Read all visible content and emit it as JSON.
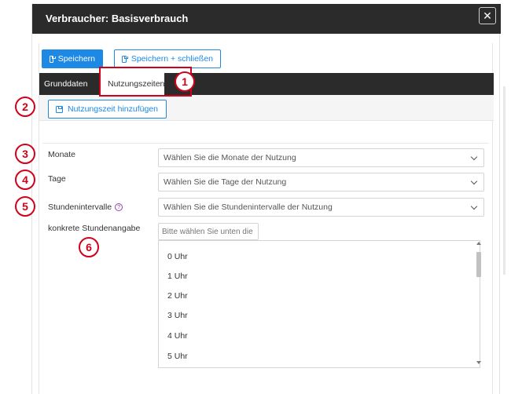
{
  "header": {
    "title": "Verbraucher: Basisverbrauch",
    "close_glyph": "✕"
  },
  "toolbar": {
    "save_label": "Speichern",
    "save_close_label": "Speichern + schließen"
  },
  "tabs": [
    {
      "label": "Grunddaten",
      "active": false
    },
    {
      "label": "Nutzungszeiten",
      "active": true
    }
  ],
  "subtoolbar": {
    "add_usage_label": "Nutzungszeit hinzufügen"
  },
  "form": {
    "monate": {
      "label": "Monate",
      "placeholder": "Wählen Sie die Monate der Nutzung"
    },
    "tage": {
      "label": "Tage",
      "placeholder": "Wählen Sie die Tage der Nutzung"
    },
    "stundenintervalle": {
      "label": "Stundenintervalle",
      "placeholder": "Wählen Sie die Stundenintervalle der Nutzung",
      "help_glyph": "?"
    },
    "konkrete": {
      "label": "konkrete Stundenangabe",
      "placeholder": "Bitte wählen Sie unten die",
      "options": [
        "0 Uhr",
        "1 Uhr",
        "2 Uhr",
        "3 Uhr",
        "4 Uhr",
        "5 Uhr"
      ]
    }
  },
  "annotations": [
    "1",
    "2",
    "3",
    "4",
    "5",
    "6"
  ],
  "colors": {
    "accent": "#1e88e5",
    "header_bg": "#2b2b2b",
    "annotation": "#d0021b",
    "active_tab_marker": "#4caf50"
  }
}
